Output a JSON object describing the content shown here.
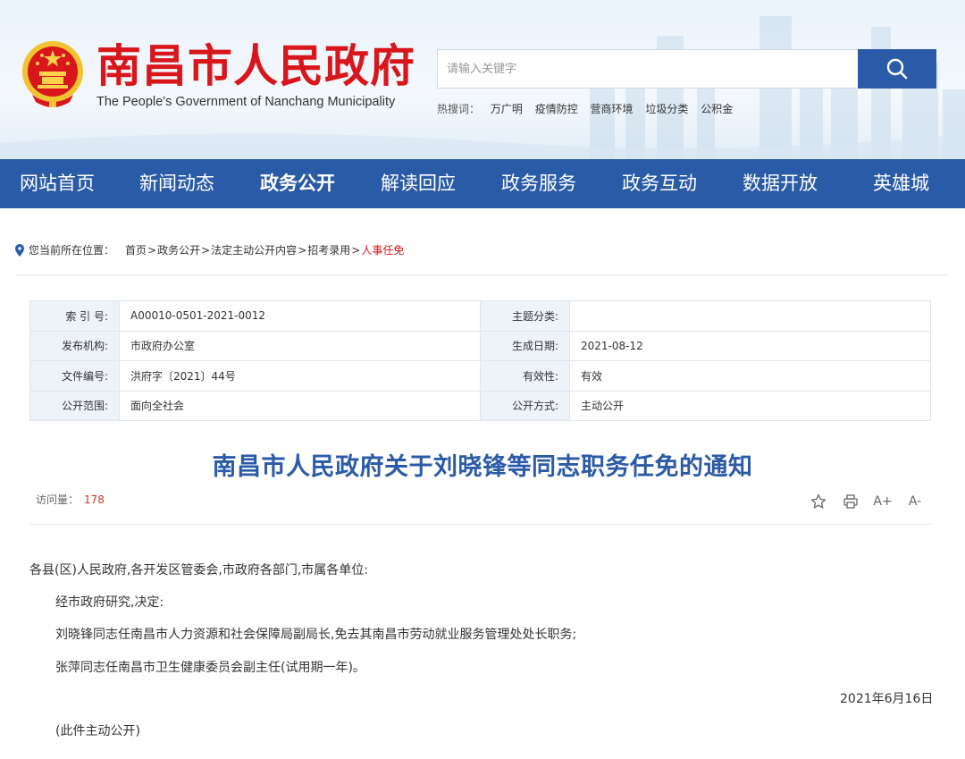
{
  "header": {
    "site_title": "南昌市人民政府",
    "site_subtitle": "The People’s Government of Nanchang Municipality",
    "search_placeholder": "请输入关键字",
    "hot_label": "热搜词：",
    "hot_words": [
      "万广明",
      "疫情防控",
      "营商环境",
      "垃圾分类",
      "公积金"
    ]
  },
  "nav": [
    "网站首页",
    "新闻动态",
    "政务公开",
    "解读回应",
    "政务服务",
    "政务互动",
    "数据开放",
    "英雄城"
  ],
  "breadcrumb": {
    "label": "您当前所在位置：",
    "items": [
      "首页",
      "政务公开",
      "法定主动公开内容",
      "招考录用",
      "人事任免"
    ]
  },
  "meta": [
    {
      "k1": "索 引 号:",
      "v1": "A00010-0501-2021-0012",
      "k2": "主题分类:",
      "v2": ""
    },
    {
      "k1": "发布机构:",
      "v1": "市政府办公室",
      "k2": "生成日期:",
      "v2": "2021-08-12"
    },
    {
      "k1": "文件编号:",
      "v1": "洪府字〔2021〕44号",
      "k2": "有效性:",
      "v2": "有效"
    },
    {
      "k1": "公开范围:",
      "v1": "面向全社会",
      "k2": "公开方式:",
      "v2": "主动公开"
    }
  ],
  "article": {
    "title": "南昌市人民政府关于刘晓锋等同志职务任免的通知",
    "views_label": "访问量：",
    "views": "178",
    "tools": {
      "font_up": "A+",
      "font_down": "A-"
    },
    "salutation": "各县(区)人民政府,各开发区管委会,市政府各部门,市属各单位:",
    "para1": "经市政府研究,决定:",
    "para2": "刘晓锋同志任南昌市人力资源和社会保障局副局长,免去其南昌市劳动就业服务管理处处长职务;",
    "para3": "张萍同志任南昌市卫生健康委员会副主任(试用期一年)。",
    "date": "2021年6月16日",
    "note": "(此件主动公开)"
  }
}
